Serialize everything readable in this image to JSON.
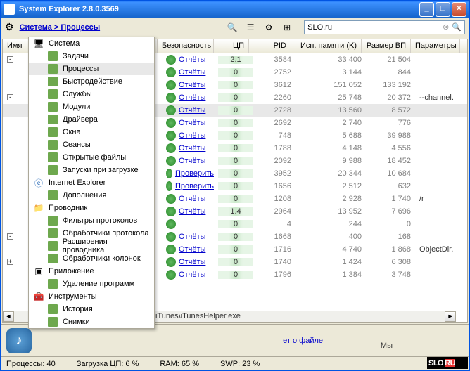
{
  "window": {
    "title": "System Explorer 2.8.0.3569"
  },
  "breadcrumb": "Система > Процессы",
  "search": {
    "value": "SLO.ru"
  },
  "columns": {
    "name": "Имя",
    "sec": "Безопасность",
    "cpu": "ЦП",
    "pid": "PID",
    "mem": "Исп. памяти (K)",
    "vm": "Размер ВП",
    "params": "Параметры"
  },
  "menu": {
    "system": "Система",
    "system_items": [
      "Задачи",
      "Процессы",
      "Быстродействие",
      "Службы",
      "Модули",
      "Драйвера",
      "Окна",
      "Сеансы",
      "Открытые файлы",
      "Запуски при загрузке"
    ],
    "ie": "Internet Explorer",
    "ie_items": [
      "Дополнения"
    ],
    "explorer": "Проводник",
    "explorer_items": [
      "Фильтры протоколов",
      "Обработчики протокола",
      "Расширения проводника",
      "Обработчики колонок"
    ],
    "app": "Приложение",
    "app_items": [
      "Удаление программ"
    ],
    "tools": "Инструменты",
    "tools_items": [
      "История",
      "Снимки"
    ]
  },
  "rows": [
    {
      "sec": "Отчёты",
      "cpu": "2.1",
      "pid": "3584",
      "mem": "33 400",
      "vm": "21 504",
      "p": ""
    },
    {
      "sec": "Отчёты",
      "cpu": "0",
      "pid": "2752",
      "mem": "3 144",
      "vm": "844",
      "p": ""
    },
    {
      "sec": "Отчёты",
      "cpu": "0",
      "pid": "3612",
      "mem": "151 052",
      "vm": "133 192",
      "p": ""
    },
    {
      "sec": "Отчёты",
      "cpu": "0",
      "pid": "2260",
      "mem": "25 748",
      "vm": "20 372",
      "p": "--channel."
    },
    {
      "sec": "Отчёты",
      "cpu": "0",
      "pid": "2728",
      "mem": "13 560",
      "vm": "8 572",
      "p": "",
      "sel": true
    },
    {
      "sec": "Отчёты",
      "cpu": "0",
      "pid": "2692",
      "mem": "2 740",
      "vm": "776",
      "p": ""
    },
    {
      "sec": "Отчёты",
      "cpu": "0",
      "pid": "748",
      "mem": "5 688",
      "vm": "39 988",
      "p": ""
    },
    {
      "sec": "Отчёты",
      "cpu": "0",
      "pid": "1788",
      "mem": "4 148",
      "vm": "4 556",
      "p": ""
    },
    {
      "sec": "Отчёты",
      "cpu": "0",
      "pid": "2092",
      "mem": "9 988",
      "vm": "18 452",
      "p": ""
    },
    {
      "sec": "Проверить",
      "cpu": "0",
      "pid": "3952",
      "mem": "20 344",
      "vm": "10 684",
      "p": ""
    },
    {
      "sec": "Проверить",
      "cpu": "0",
      "pid": "1656",
      "mem": "2 512",
      "vm": "632",
      "p": ""
    },
    {
      "sec": "Отчёты",
      "cpu": "0",
      "pid": "1208",
      "mem": "2 928",
      "vm": "1 740",
      "p": "/r"
    },
    {
      "sec": "Отчёты",
      "cpu": "1.4",
      "pid": "2964",
      "mem": "13 952",
      "vm": "7 696",
      "p": ""
    },
    {
      "sec": "",
      "cpu": "0",
      "pid": "4",
      "mem": "244",
      "vm": "0",
      "p": ""
    },
    {
      "sec": "Отчёты",
      "cpu": "0",
      "pid": "1668",
      "mem": "400",
      "vm": "168",
      "p": ""
    },
    {
      "sec": "Отчёты",
      "cpu": "0",
      "pid": "1716",
      "mem": "4 740",
      "vm": "1 868",
      "p": "ObjectDir."
    },
    {
      "sec": "Отчёты",
      "cpu": "0",
      "pid": "1740",
      "mem": "1 424",
      "vm": "6 308",
      "p": ""
    },
    {
      "sec": "Отчёты",
      "cpu": "0",
      "pid": "1796",
      "mem": "1 384",
      "vm": "3 748",
      "p": ""
    }
  ],
  "path_fragment": "iTunes\\iTunesHelper.exe",
  "file_link": "ет о файле",
  "right_text": "Мы",
  "status": {
    "proc": "Процессы: 40",
    "cpu": "Загрузка ЦП: 6 %",
    "ram": "RAM: 65 %",
    "swp": "SWP: 23 %"
  },
  "watermark": {
    "text": "SLO",
    "suffix": "RU"
  }
}
